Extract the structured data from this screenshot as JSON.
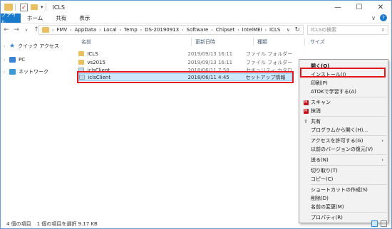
{
  "window": {
    "title": "ICLS"
  },
  "win_controls": {
    "minimize": "—",
    "maximize": "☐",
    "close": "✕"
  },
  "ribbon": {
    "file_tab": "ファイル",
    "tabs": [
      "ホーム",
      "共有",
      "表示"
    ],
    "expand": "∨"
  },
  "nav": {
    "back": "←",
    "forward": "→",
    "up_arrow": "∨",
    "up": "↑"
  },
  "address": {
    "crumbs": [
      "FMV",
      "AppData",
      "Local",
      "Temp",
      "DS-20190913",
      "Software",
      "Chipset",
      "IntelMEI",
      "ICLS"
    ]
  },
  "search": {
    "placeholder": "ICLSの検索"
  },
  "navpane": {
    "quick_access": "クイック アクセス",
    "pc": "PC",
    "network": "ネットワーク"
  },
  "columns": {
    "name": "名前",
    "date": "更新日時",
    "type": "種類",
    "size": "サイズ"
  },
  "files": [
    {
      "name": "ICLS",
      "date": "2019/09/13 16:11",
      "type": "ファイル フォルダー",
      "kind": "folder"
    },
    {
      "name": "vs2015",
      "date": "2019/09/13 16:11",
      "type": "ファイル フォルダー",
      "kind": "folder"
    },
    {
      "name": "iclsClient",
      "date": "2018/06/11 7:58",
      "type": "セキュリティ カタログ",
      "kind": "file"
    },
    {
      "name": "iclsClient",
      "date": "2018/06/11 4:45",
      "type": "セットアップ情報",
      "kind": "file",
      "selected": true
    }
  ],
  "context_menu": {
    "open": "開く(O)",
    "install": "インストール(I)",
    "print": "印刷(P)",
    "atok": "ATOKで学習する(A)",
    "scan": "スキャン",
    "erase": "抹消",
    "share": "共有",
    "open_with": "プログラムから開く(H)...",
    "give_access": "アクセスを許可する(G)",
    "restore": "以前のバージョンの復元(V)",
    "send_to": "送る(N)",
    "cut": "切り取り(T)",
    "copy": "コピー(C)",
    "shortcut": "ショートカットの作成(S)",
    "delete": "削除(D)",
    "rename": "名前の変更(M)",
    "properties": "プロパティ(R)"
  },
  "status": {
    "count": "4 個の項目",
    "selection": "1 個の項目を選択  9.17 KB"
  },
  "colors": {
    "highlight": "#e3161e",
    "selection": "#cce8ff",
    "accent": "#1979ca"
  }
}
